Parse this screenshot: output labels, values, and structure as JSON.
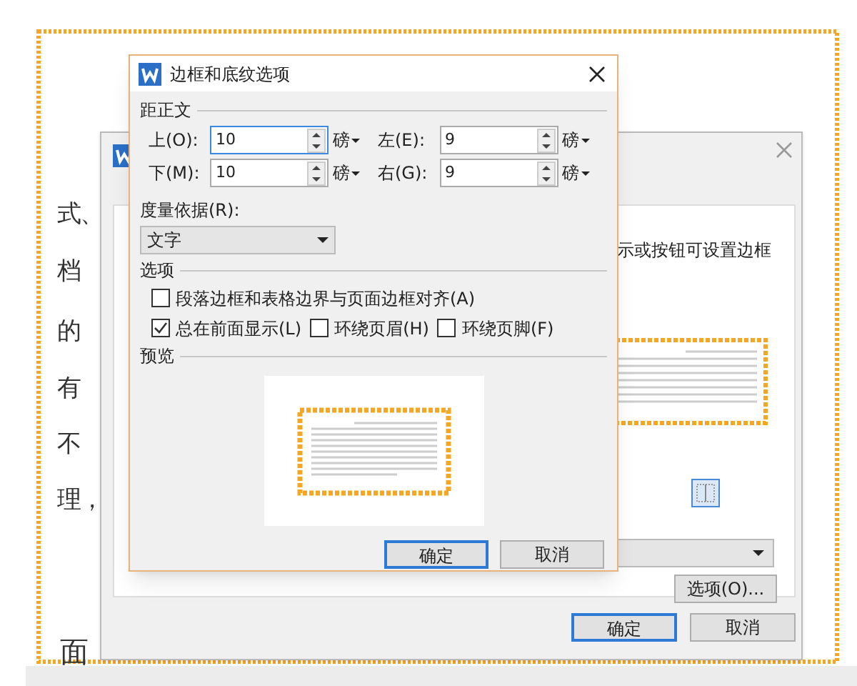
{
  "document": {
    "left_fragments": [
      "式、",
      "档",
      "的",
      "有",
      "不",
      "理，"
    ],
    "bottom_fragment": "面"
  },
  "back_dialog": {
    "hint": "示或按钮可设置边框",
    "options_button": "选项(O)...",
    "buttons": [
      {
        "label": "确定",
        "default": true
      },
      {
        "label": "取消",
        "default": false
      }
    ]
  },
  "dialog": {
    "title": "边框和底纹选项",
    "margin_group": "距正文",
    "margins": [
      {
        "label": "上(O):",
        "value": "10",
        "unit": "磅",
        "focused": true
      },
      {
        "label": "左(E):",
        "value": "9",
        "unit": "磅",
        "focused": false
      },
      {
        "label": "下(M):",
        "value": "10",
        "unit": "磅",
        "focused": false
      },
      {
        "label": "右(G):",
        "value": "9",
        "unit": "磅",
        "focused": false
      }
    ],
    "measure_label": "度量依据(R):",
    "measure_value": "文字",
    "options_group": "选项",
    "option_rows": [
      [
        {
          "label": "段落边框和表格边界与页面边框对齐(A)",
          "checked": false
        }
      ],
      [
        {
          "label": "总在前面显示(L)",
          "checked": true
        },
        {
          "label": "环绕页眉(H)",
          "checked": false
        },
        {
          "label": "环绕页脚(F)",
          "checked": false
        }
      ]
    ],
    "preview_group": "预览",
    "buttons": [
      {
        "label": "确定",
        "default": true
      },
      {
        "label": "取消",
        "default": false
      }
    ]
  }
}
